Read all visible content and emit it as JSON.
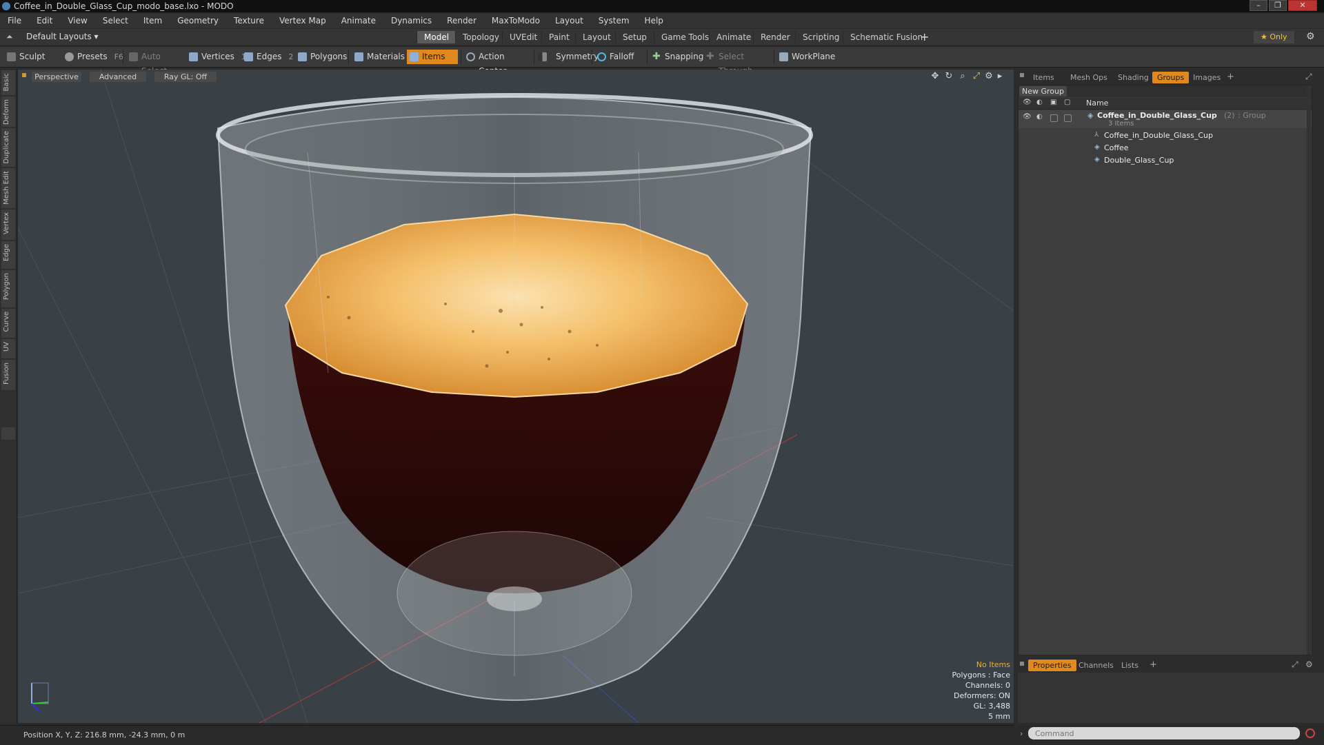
{
  "window": {
    "title": "Coffee_in_Double_Glass_Cup_modo_base.lxo - MODO",
    "controls": [
      "–",
      "❐",
      "✕"
    ]
  },
  "menu": [
    "File",
    "Edit",
    "View",
    "Select",
    "Item",
    "Geometry",
    "Texture",
    "Vertex Map",
    "Animate",
    "Dynamics",
    "Render",
    "MaxToModo",
    "Layout",
    "System",
    "Help"
  ],
  "layout_selector": "Default Layouts ▾",
  "layout_tabs": [
    "Model",
    "Topology",
    "UVEdit",
    "Paint",
    "Layout",
    "Setup",
    "Game Tools",
    "Animate",
    "Render",
    "Scripting",
    "Schematic Fusion"
  ],
  "layout_add": "+",
  "only_label": "★ Only",
  "toolbar": {
    "sculpt": "Sculpt",
    "presets": "Presets",
    "presets_key": "F6",
    "auto_select": "Auto Select",
    "vertices": "Vertices",
    "vertices_key": "1",
    "edges": "Edges",
    "edges_key": "2",
    "polygons": "Polygons",
    "materials": "Materials",
    "items": "Items",
    "action_center": "Action Center",
    "symmetry": "Symmetry",
    "falloff": "Falloff",
    "snapping": "Snapping",
    "select_through": "Select Through",
    "workplane": "WorkPlane"
  },
  "side_tabs": [
    "Basic",
    "Deform",
    "Duplicate",
    "Mesh Edit",
    "Vertex",
    "Edge",
    "Polygon",
    "Curve",
    "UV",
    "Fusion"
  ],
  "viewport": {
    "view_mode": "Perspective",
    "shading": "Advanced",
    "raygl": "Ray GL: Off",
    "stats": {
      "selection": "No Items",
      "polygons": "Polygons : Face",
      "channels": "Channels: 0",
      "deformers": "Deformers: ON",
      "gl": "GL: 3,488",
      "scale": "5 mm"
    }
  },
  "status": "Position X, Y, Z:   216.8 mm, -24.3 mm, 0 m",
  "right_panel": {
    "tabs": [
      "Items",
      "Mesh Ops",
      "Shading",
      "Groups",
      "Images"
    ],
    "active_tab": "Groups",
    "add": "+",
    "new_group": "New Group",
    "column_name": "Name",
    "group": {
      "name": "Coffee_in_Double_Glass_Cup",
      "count": "(2)",
      "type": ": Group",
      "subtitle": "3 Items",
      "children": [
        "Coffee_in_Double_Glass_Cup",
        "Coffee",
        "Double_Glass_Cup"
      ]
    },
    "bottom_tabs": [
      "Properties",
      "Channels",
      "Lists"
    ],
    "command_placeholder": "Command"
  },
  "colors": {
    "accent": "#e08a1e",
    "viewport_bg": "#3a4146",
    "crema": "#f2b04e",
    "coffee": "#2a0a08"
  }
}
